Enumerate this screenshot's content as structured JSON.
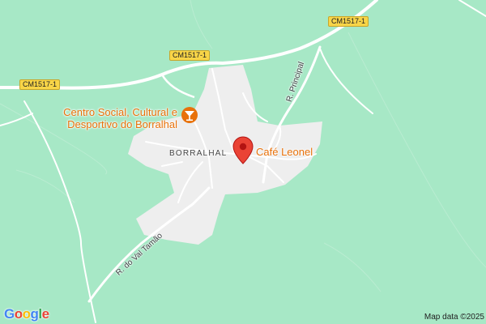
{
  "map": {
    "colors": {
      "land": "#a7e8c6",
      "built_area": "#eeeeee",
      "road": "#ffffff",
      "poi": "#e8710a",
      "marker": "#ea4335"
    },
    "highway_labels": [
      "CM1517-1",
      "CM1517-1",
      "CM1517-1"
    ],
    "street_labels": [
      "R. Principal",
      "R. do Val Tamão"
    ],
    "locality": "BORRALHAL",
    "pois": [
      {
        "name_line1": "Centro Social, Cultural e",
        "name_line2": "Desportivo do Borralhal",
        "icon": "cocktail-bar-icon"
      },
      {
        "name": "Café Leonel",
        "icon": "map-pin-icon"
      }
    ],
    "attribution": "Map data ©2025",
    "logo": {
      "letters": [
        "G",
        "o",
        "o",
        "g",
        "l",
        "e"
      ],
      "colors": [
        "#4285f4",
        "#ea4335",
        "#fbbc05",
        "#4285f4",
        "#34a853",
        "#ea4335"
      ]
    }
  }
}
